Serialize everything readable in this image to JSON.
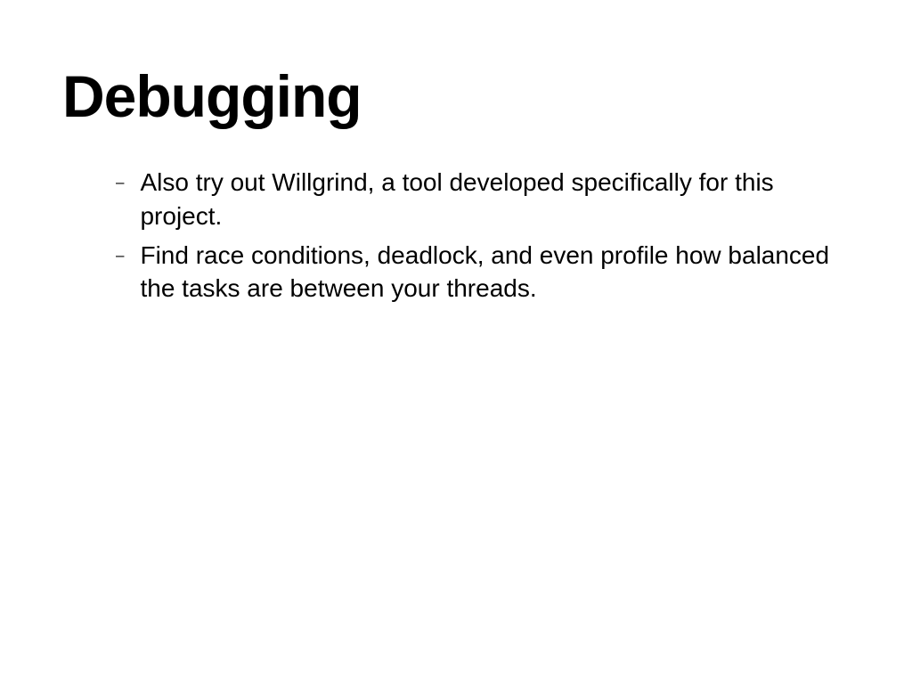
{
  "slide": {
    "title": "Debugging",
    "bullets": [
      "Also try out Willgrind, a tool developed specifically for this project.",
      "Find race conditions, deadlock, and even profile how balanced the tasks are between your threads."
    ],
    "bullet_marker": "–"
  }
}
